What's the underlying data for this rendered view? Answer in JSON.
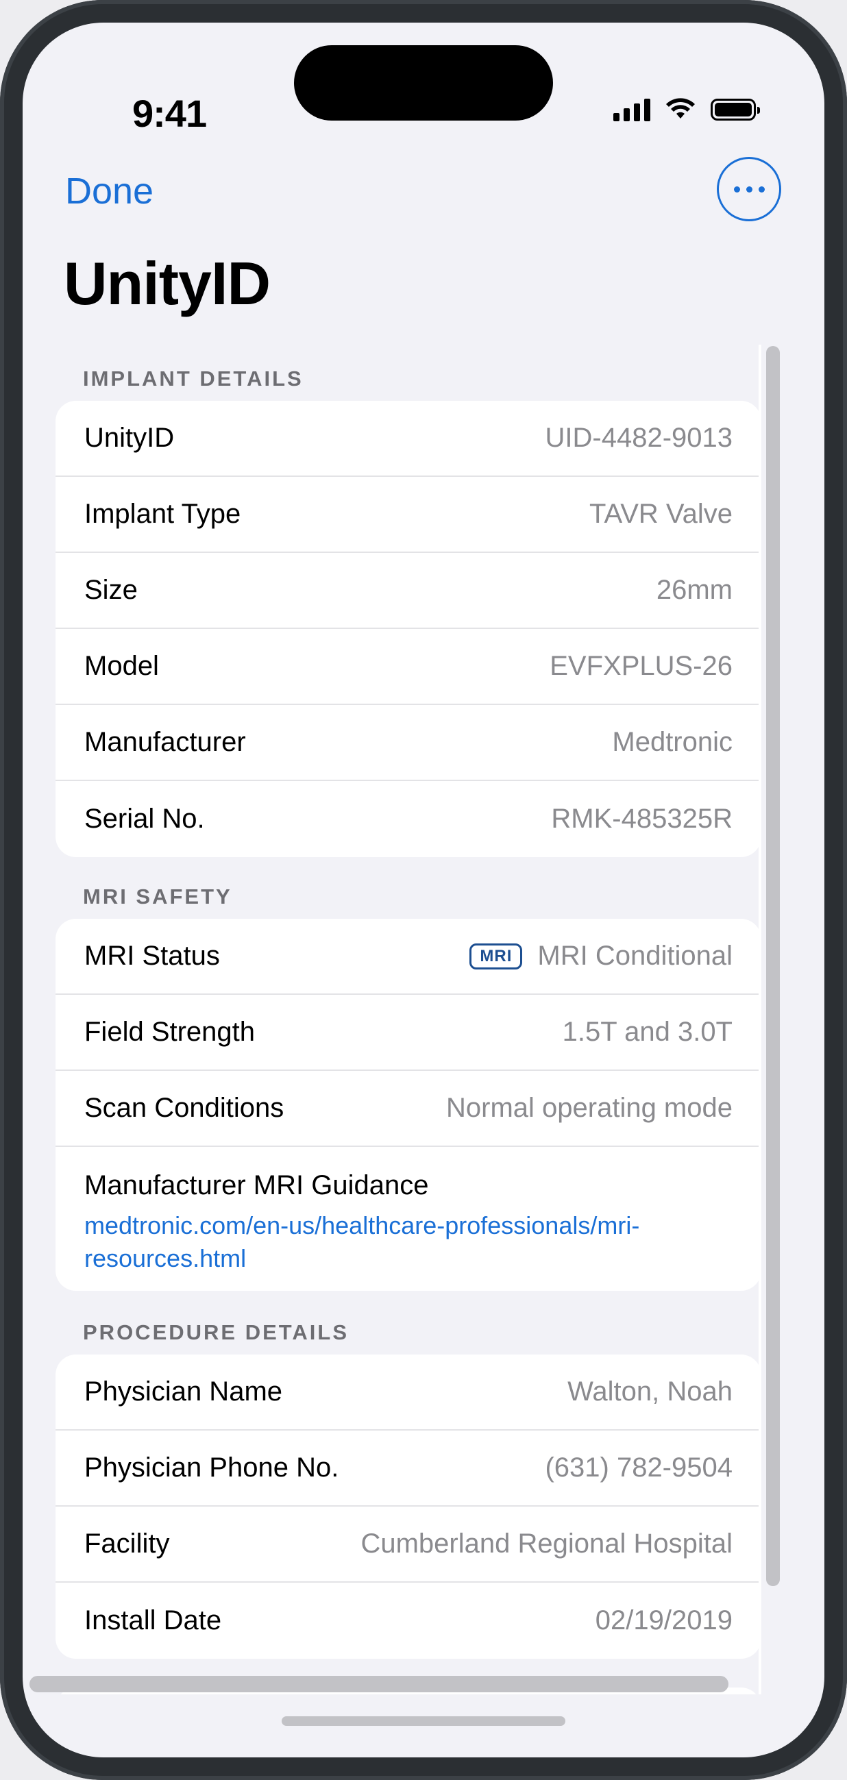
{
  "status_bar": {
    "time": "9:41"
  },
  "nav": {
    "done_label": "Done",
    "more_icon": "ellipsis-icon"
  },
  "title": "UnityID",
  "sections": {
    "implant": {
      "header": "IMPLANT DETAILS",
      "rows": [
        {
          "label": "UnityID",
          "value": "UID-4482-9013"
        },
        {
          "label": "Implant Type",
          "value": "TAVR Valve"
        },
        {
          "label": "Size",
          "value": "26mm"
        },
        {
          "label": "Model",
          "value": "EVFXPLUS-26"
        },
        {
          "label": "Manufacturer",
          "value": "Medtronic"
        },
        {
          "label": "Serial No.",
          "value": "RMK-485325R"
        }
      ]
    },
    "mri": {
      "header": "MRI SAFETY",
      "status": {
        "label": "MRI Status",
        "badge": "MRI",
        "value": "MRI Conditional"
      },
      "rows": [
        {
          "label": "Field Strength",
          "value": "1.5T and 3.0T"
        },
        {
          "label": "Scan Conditions",
          "value": "Normal operating mode"
        }
      ],
      "guidance": {
        "label": "Manufacturer MRI Guidance",
        "link": "medtronic.com/en-us/healthcare-professionals/mri-resources.html"
      }
    },
    "procedure": {
      "header": "PROCEDURE DETAILS",
      "rows": [
        {
          "label": "Physician Name",
          "value": "Walton, Noah"
        },
        {
          "label": "Physician Phone No.",
          "value": "(631) 782-9504"
        },
        {
          "label": "Facility",
          "value": "Cumberland Regional Hospital"
        },
        {
          "label": "Install Date",
          "value": "02/19/2019"
        }
      ]
    }
  },
  "colors": {
    "accent": "#1a6fd6",
    "badge": "#1d4f91",
    "background": "#f2f2f7"
  }
}
